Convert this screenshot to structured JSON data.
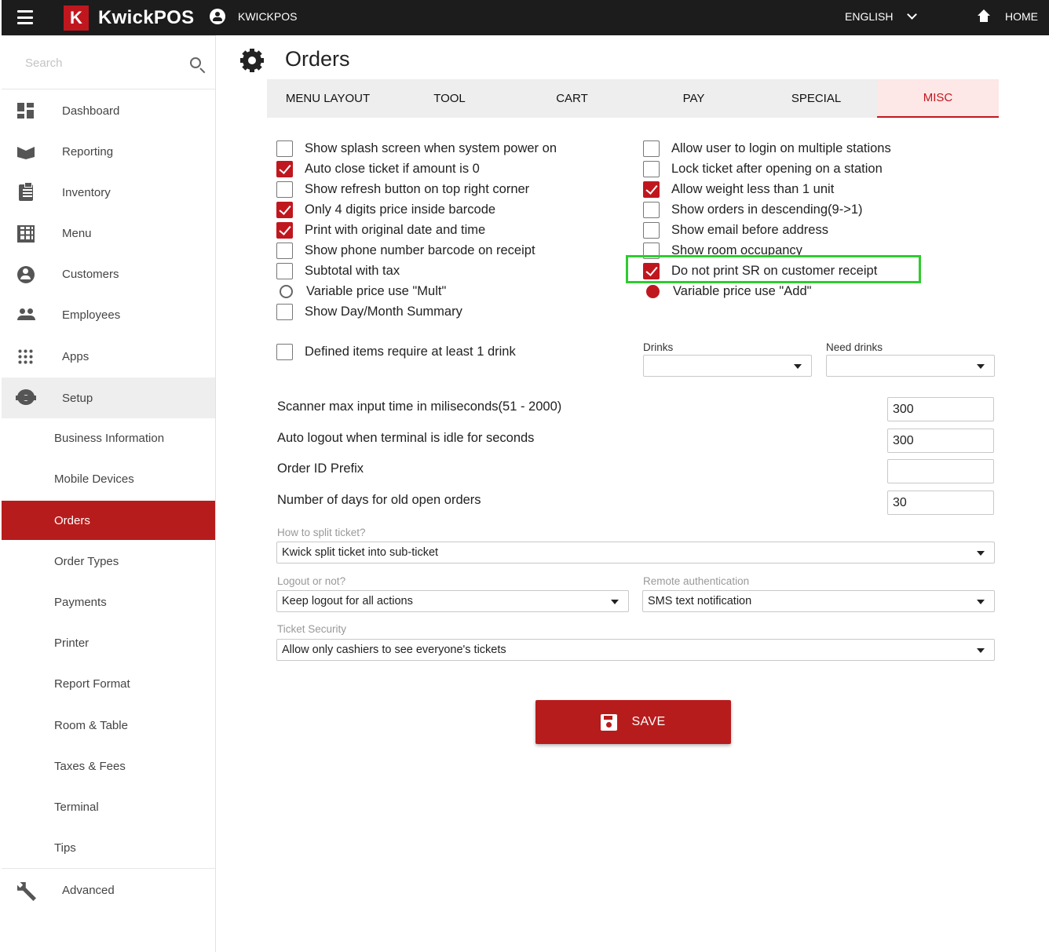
{
  "topbar": {
    "brand": "KwickPOS",
    "logo_letter": "K",
    "account_name": "KWICKPOS",
    "language": "ENGLISH",
    "home_label": "HOME"
  },
  "sidebar": {
    "search_placeholder": "Search",
    "items": [
      {
        "label": "Dashboard",
        "icon": "dashboard-icon"
      },
      {
        "label": "Reporting",
        "icon": "reporting-icon"
      },
      {
        "label": "Inventory",
        "icon": "inventory-icon"
      },
      {
        "label": "Menu",
        "icon": "menu-grid-icon"
      },
      {
        "label": "Customers",
        "icon": "customer-icon"
      },
      {
        "label": "Employees",
        "icon": "employees-icon"
      },
      {
        "label": "Apps",
        "icon": "apps-icon"
      },
      {
        "label": "Setup",
        "icon": "gear-icon"
      }
    ],
    "setup_children": [
      "Business Information",
      "Mobile Devices",
      "Orders",
      "Order Types",
      "Payments",
      "Printer",
      "Report Format",
      "Room & Table",
      "Taxes & Fees",
      "Terminal",
      "Tips"
    ],
    "selected_child": "Orders",
    "advanced_label": "Advanced"
  },
  "page": {
    "title": "Orders"
  },
  "tabs": [
    "MENU LAYOUT",
    "TOOL",
    "CART",
    "PAY",
    "SPECIAL",
    "MISC"
  ],
  "active_tab": "MISC",
  "options_left": [
    {
      "label": "Show splash screen when system power on",
      "checked": false,
      "type": "checkbox"
    },
    {
      "label": "Auto close ticket if amount is 0",
      "checked": true,
      "type": "checkbox"
    },
    {
      "label": "Show refresh button on top right corner",
      "checked": false,
      "type": "checkbox"
    },
    {
      "label": "Only 4 digits price inside barcode",
      "checked": true,
      "type": "checkbox"
    },
    {
      "label": "Print with original date and time",
      "checked": true,
      "type": "checkbox"
    },
    {
      "label": "Show phone number barcode on receipt",
      "checked": false,
      "type": "checkbox"
    },
    {
      "label": "Subtotal with tax",
      "checked": false,
      "type": "checkbox"
    },
    {
      "label": "Variable price use \"Mult\"",
      "checked": false,
      "type": "radio"
    },
    {
      "label": "Show Day/Month Summary",
      "checked": false,
      "type": "checkbox"
    }
  ],
  "options_right": [
    {
      "label": "Allow user to login on multiple stations",
      "checked": false,
      "type": "checkbox"
    },
    {
      "label": "Lock ticket after opening on a station",
      "checked": false,
      "type": "checkbox"
    },
    {
      "label": "Allow weight less than 1 unit",
      "checked": true,
      "type": "checkbox"
    },
    {
      "label": "Show orders in descending(9->1)",
      "checked": false,
      "type": "checkbox"
    },
    {
      "label": "Show email before address",
      "checked": false,
      "type": "checkbox"
    },
    {
      "label": "Show room occupancy",
      "checked": false,
      "type": "checkbox"
    },
    {
      "label": "Do not print SR on customer receipt",
      "checked": true,
      "type": "checkbox"
    },
    {
      "label": "Variable price use \"Add\"",
      "checked": true,
      "type": "radio"
    }
  ],
  "drink_option": {
    "label": "Defined items require at least 1 drink",
    "checked": false
  },
  "drinks": {
    "label": "Drinks",
    "value": ""
  },
  "need_drinks": {
    "label": "Need drinks",
    "value": ""
  },
  "numeric_fields": [
    {
      "label": "Scanner max input time in miliseconds(51 - 2000)",
      "value": "300"
    },
    {
      "label": "Auto logout when terminal is idle for seconds",
      "value": "300"
    },
    {
      "label": "Order ID Prefix",
      "value": ""
    },
    {
      "label": "Number of days for old open orders",
      "value": "30"
    }
  ],
  "split_ticket": {
    "label": "How to split ticket?",
    "value": "Kwick split ticket into sub-ticket"
  },
  "logout": {
    "label": "Logout or not?",
    "value": "Keep logout for all actions"
  },
  "remote_auth": {
    "label": "Remote authentication",
    "value": "SMS text notification"
  },
  "ticket_security": {
    "label": "Ticket Security",
    "value": "Allow only cashiers to see everyone's tickets"
  },
  "save_label": "SAVE",
  "colors": {
    "brand_red": "#c0171f",
    "selected_bg": "#b71c1c",
    "highlight_green": "#2ecc2e",
    "topbar": "#1c1c1c"
  }
}
